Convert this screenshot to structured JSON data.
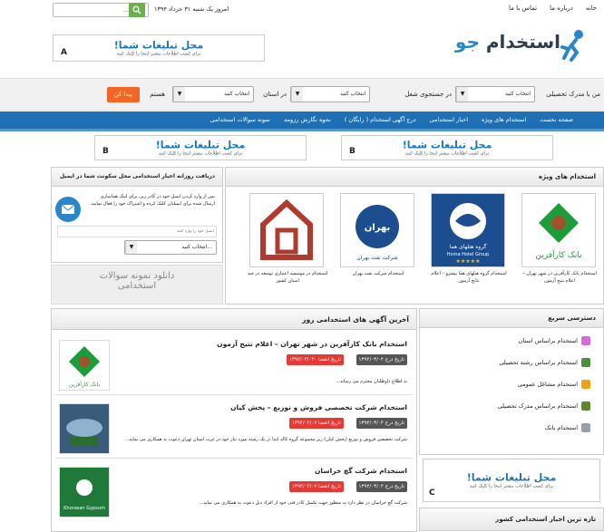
{
  "header": {
    "top_links": [
      "خانه",
      "درباره ما",
      "تماس با ما"
    ],
    "date_text": "امروز یک شنبه ۳۱ خرداد ۱۳۹۴",
    "search_placeholder": "جستجو ..."
  },
  "logo": {
    "brand": "استخدام",
    "brand_suffix": "جو"
  },
  "ads": {
    "title": "محل تبلیغات شما!",
    "subtitle": "برای کسب اطلاعات بیشتر اینجا را کلیک کنید",
    "letters": {
      "a": "A",
      "b": "B",
      "c": "C"
    }
  },
  "filter": {
    "label_degree": "من با مدرک تحصیلی",
    "label_field": "در جستجوی شغل",
    "label_province": "در استان",
    "label_am": "هستم",
    "select_text": "انتخاب کنید",
    "button": "پیدا کن"
  },
  "nav": {
    "items": [
      "صفحه نخست",
      "استخدام های ویژه",
      "اخبار استخدامی",
      "درج آگهی استخدام ( رایگان )",
      "نحوه نگارش رزومه",
      "نمونه سوالات استخدامی"
    ]
  },
  "special_jobs": {
    "title": "استخدام های ویژه",
    "logo_texts": [
      "بانک کارآفرین",
      "گروه هتلهای هما",
      "شرکت نفت بهران",
      ""
    ],
    "hotel_en": "Homa Hotel Group",
    "cards": [
      "استخدام بانک کارآفرین در شهر تهران – اعلام نتیج آزمون",
      "استخدام گروه هتلهای هما پیشرو – اعلام نتایج آزمون",
      "استخدام شرکت نفت بهران",
      "استخدام در موسسه اعتباری توسعه در چند استان کشور"
    ]
  },
  "newsletter": {
    "title": "دریافت روزانه اخبار استخدامی محل سکونت شما در ایمیل",
    "text": "پس از وارد کردن ایمیل خود در کادر زیر، برای لینک هماسازی ارسال شده برای ایمیلتان کلیک کرده و اشتراک خود را فعال نمایید.",
    "email_placeholder": "ایمیل خود را وارد کنید",
    "select_text": "...انتخاب کنید"
  },
  "sample_box": {
    "line1": "دانلود نمونه سوالات",
    "line2": "استخدامی"
  },
  "latest": {
    "title": "آخرین آگهی های استخدامی روز",
    "jobs": [
      {
        "title": "استخدام بانک کارآفرین در شهر تهران – اعلام نتیج آزمون",
        "date_in": "تاریخ درج ۱۳۹۴/۰۳/۰۴",
        "date_exp": "تاریخ انقضا ۱۳۹۴/۰۳/۰۳۰",
        "desc": "به اطلاع داوطلبان محترم می رساند..."
      },
      {
        "title": "استخدام شرکت تخصصی فروش و توزیع – پخش کیان",
        "date_in": "تاریخ درج ۱۳۹۴/۰۳/۰۴",
        "date_exp": "تاریخ انقضا ۱۳۹۴/۰۴/۰۷",
        "desc": "شرکت تخصصی فروش و توزیع (پخش کیان) زیر مجموعه گروه کاله ایتنا در یک رشته مورد نیاز خود در غرب استان تهران دعوت به همکاری می نماید..."
      },
      {
        "title": "استخدام شرکت گچ خراسان",
        "date_in": "تاریخ درج ۱۳۹۴/۰۳/۰۴",
        "date_exp": "تاریخ انقضا ۱۳۹۴/۰۴/۰۷",
        "desc": "شرکت گچ خراسان در نظر دارد به منظور جهت تکمیل کادر فنی خود از افراد ذیل دعوت به همکاری می نماید..."
      }
    ],
    "img_texts": [
      "بانک کارآفرین",
      "",
      "Khorasan Gypsum"
    ]
  },
  "quick": {
    "title": "دسترسی سریع",
    "items": [
      "استخدام براساس استان",
      "استخدام براساس رشته تحصیلی",
      "استخدام مشاغل عمومی",
      "استخدام براساس مدرک تحصیلی",
      "استخدام بانک"
    ]
  },
  "newest": {
    "title": "تازه ترین اخبار استخدامی کشور"
  },
  "colors": {
    "nav": "#1f6fb4",
    "accent": "#f26522",
    "green": "#6ab04c",
    "red": "#e53935",
    "gray_pill": "#555555"
  }
}
